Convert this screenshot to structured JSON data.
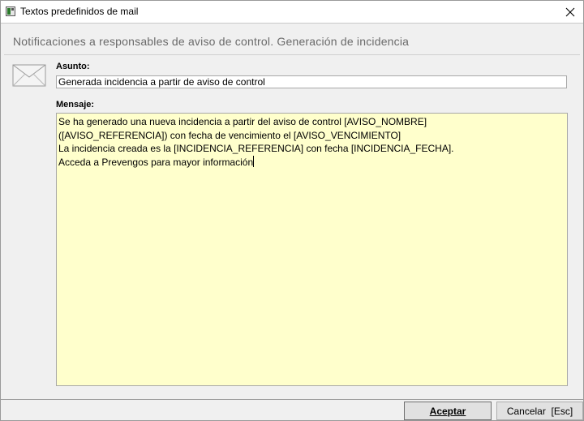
{
  "window": {
    "title": "Textos predefinidos de mail",
    "icon": "app-icon",
    "close_icon": "close-icon"
  },
  "heading": "Notificaciones a responsables de aviso de control. Generación de incidencia",
  "form": {
    "icon": "mail-icon",
    "subject_label": "Asunto:",
    "subject_value": "Generada incidencia a partir de aviso de control",
    "message_label": "Mensaje:",
    "message_lines": [
      "Se ha generado una nueva incidencia a partir del aviso de control [AVISO_NOMBRE]",
      "([AVISO_REFERENCIA]) con fecha de vencimiento el [AVISO_VENCIMIENTO]",
      "La incidencia creada es la [INCIDENCIA_REFERENCIA] con fecha [INCIDENCIA_FECHA].",
      "Acceda a Prevengos para mayor información"
    ],
    "message_background": "#ffffcc"
  },
  "buttons": {
    "accept_label": "Aceptar",
    "cancel_label": "Cancelar  [Esc]"
  }
}
